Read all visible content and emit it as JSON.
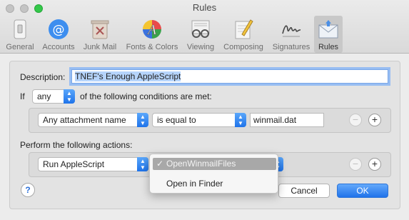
{
  "window": {
    "title": "Rules"
  },
  "toolbar": {
    "items": [
      {
        "label": "General",
        "icon": "general-switch-icon"
      },
      {
        "label": "Accounts",
        "icon": "at-sign-icon"
      },
      {
        "label": "Junk Mail",
        "icon": "trash-bin-icon"
      },
      {
        "label": "Fonts & Colors",
        "icon": "font-colors-icon"
      },
      {
        "label": "Viewing",
        "icon": "glasses-icon"
      },
      {
        "label": "Composing",
        "icon": "pencil-notepad-icon"
      },
      {
        "label": "Signatures",
        "icon": "signature-icon"
      },
      {
        "label": "Rules",
        "icon": "envelope-rules-icon"
      }
    ],
    "active": "Rules"
  },
  "rule": {
    "description_label": "Description:",
    "description_value": "TNEF's Enough AppleScript",
    "if_label": "If",
    "match_value": "any",
    "conditions_suffix": "of the following conditions are met:",
    "condition": {
      "field": "Any attachment name",
      "operator": "is equal to",
      "value": "winmail.dat"
    },
    "actions_label": "Perform the following actions:",
    "action": {
      "type": "Run AppleScript"
    }
  },
  "menu": {
    "items": [
      {
        "label": "OpenWinmailFiles",
        "checked": true,
        "check_glyph": "✓"
      },
      {
        "label": "Open in Finder",
        "checked": false
      }
    ]
  },
  "buttons": {
    "help": "?",
    "cancel": "Cancel",
    "ok": "OK",
    "minus": "−",
    "plus": "+"
  },
  "colors": {
    "accent": "#2072ea",
    "menu_highlight": "#a8a8a8"
  }
}
